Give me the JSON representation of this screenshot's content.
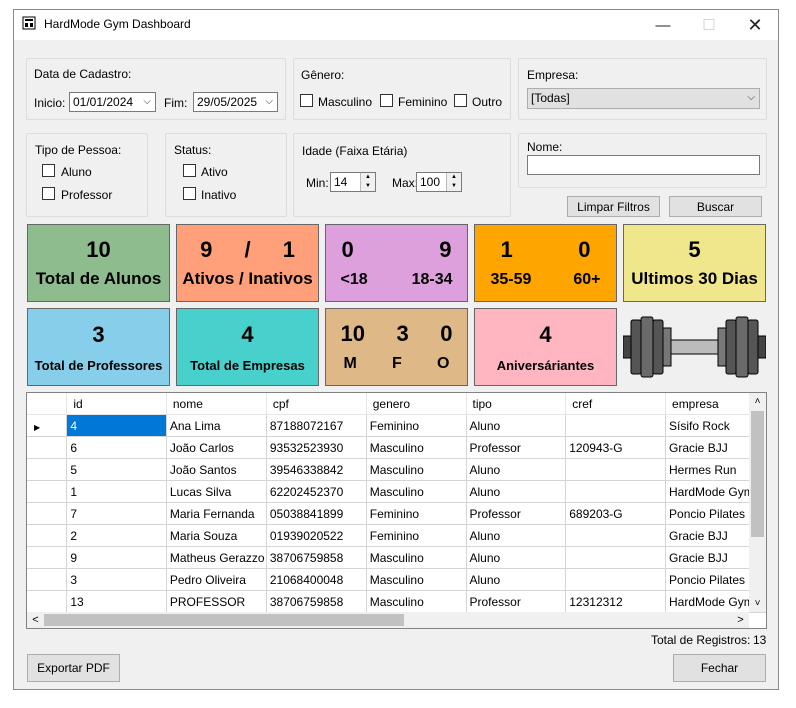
{
  "window": {
    "title": "HardMode Gym Dashboard"
  },
  "filters": {
    "date_group_label": "Data de Cadastro:",
    "start_label": "Inicio:",
    "start_value": "01/01/2024",
    "end_label": "Fim:",
    "end_value": "29/05/2025",
    "gender_label": "Gênero:",
    "gender_options": [
      "Masculino",
      "Feminino",
      "Outro"
    ],
    "company_label": "Empresa:",
    "company_value": "[Todas]",
    "person_type_label": "Tipo de Pessoa:",
    "person_types": [
      "Aluno",
      "Professor"
    ],
    "status_label": "Status:",
    "status_options": [
      "Ativo",
      "Inativo"
    ],
    "age_label": "Idade (Faixa Etária)",
    "age_min_label": "Min:",
    "age_min_value": "14",
    "age_max_label": "Max:",
    "age_max_value": "100",
    "name_label": "Nome:",
    "name_value": "",
    "clear_button": "Limpar Filtros",
    "search_button": "Buscar"
  },
  "cards": {
    "total_alunos": {
      "value": "10",
      "label": "Total de Alunos",
      "color": "#8fbc8f"
    },
    "ativos_inativos": {
      "ativos": "9",
      "sep": "/",
      "inativos": "1",
      "label": "Ativos / Inativos",
      "color": "#ffa07a"
    },
    "idade1": {
      "v1": "0",
      "v2": "9",
      "l1": "<18",
      "l2": "18-34",
      "color": "#dda0dd"
    },
    "idade2": {
      "v1": "1",
      "v2": "0",
      "l1": "35-59",
      "l2": "60+",
      "color": "#ffa500"
    },
    "ultimos30": {
      "value": "5",
      "label": "Ultimos 30 Dias",
      "color": "#f0e68c"
    },
    "professores": {
      "value": "3",
      "label": "Total de Professores",
      "color": "#87ceeb"
    },
    "empresas": {
      "value": "4",
      "label": "Total de Empresas",
      "color": "#48d1cc"
    },
    "genero": {
      "m": "10",
      "f": "3",
      "o": "0",
      "lm": "M",
      "lf": "F",
      "lo": "O",
      "color": "#deb887"
    },
    "aniversariantes": {
      "value": "4",
      "label": "Aniversáriantes",
      "color": "#ffb6c1"
    }
  },
  "grid": {
    "columns": [
      "id",
      "nome",
      "cpf",
      "genero",
      "tipo",
      "cref",
      "empresa"
    ],
    "rows": [
      [
        "4",
        "Ana Lima",
        "87188072167",
        "Feminino",
        "Aluno",
        "",
        "Sísifo Rock"
      ],
      [
        "6",
        "João Carlos",
        "93532523930",
        "Masculino",
        "Professor",
        "120943-G",
        "Gracie BJJ"
      ],
      [
        "5",
        "João Santos",
        "39546338842",
        "Masculino",
        "Aluno",
        "",
        "Hermes Run"
      ],
      [
        "1",
        "Lucas Silva",
        "62202452370",
        "Masculino",
        "Aluno",
        "",
        "HardMode Gym"
      ],
      [
        "7",
        "Maria Fernanda",
        "05038841899",
        "Feminino",
        "Professor",
        "689203-G",
        "Poncio Pilates"
      ],
      [
        "2",
        "Maria Souza",
        "01939020522",
        "Feminino",
        "Aluno",
        "",
        "Gracie BJJ"
      ],
      [
        "9",
        "Matheus Gerazzo",
        "38706759858",
        "Masculino",
        "Aluno",
        "",
        "Gracie BJJ"
      ],
      [
        "3",
        "Pedro Oliveira",
        "21068400048",
        "Masculino",
        "Aluno",
        "",
        "Poncio Pilates"
      ],
      [
        "13",
        "PROFESSOR",
        "38706759858",
        "Masculino",
        "Professor",
        "12312312",
        "HardMode Gym"
      ]
    ]
  },
  "footer": {
    "total_label": "Total de Registros:",
    "total_value": "13",
    "export_button": "Exportar PDF",
    "close_button": "Fechar"
  }
}
